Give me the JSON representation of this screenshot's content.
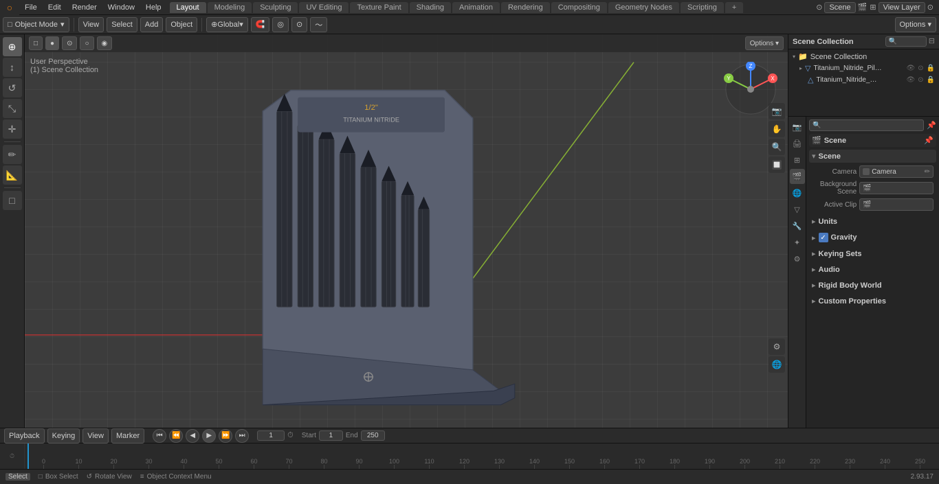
{
  "app": {
    "title": "Blender",
    "version": "2.93.17"
  },
  "menu_bar": {
    "logo": "○",
    "items": [
      "File",
      "Edit",
      "Render",
      "Window",
      "Help"
    ],
    "workspace_tabs": [
      {
        "label": "Layout",
        "active": true
      },
      {
        "label": "Modeling"
      },
      {
        "label": "Sculpting"
      },
      {
        "label": "UV Editing"
      },
      {
        "label": "Texture Paint"
      },
      {
        "label": "Shading"
      },
      {
        "label": "Animation"
      },
      {
        "label": "Rendering"
      },
      {
        "label": "Compositing"
      },
      {
        "label": "Geometry Nodes"
      },
      {
        "label": "Scripting"
      },
      {
        "label": "+"
      }
    ],
    "scene_name": "Scene",
    "view_layer": "View Layer"
  },
  "toolbar": {
    "mode": "Object Mode",
    "view_label": "View",
    "select_label": "Select",
    "add_label": "Add",
    "object_label": "Object",
    "global_label": "Global",
    "options_label": "Options ▾"
  },
  "left_tools": [
    {
      "name": "cursor-tool",
      "icon": "+"
    },
    {
      "name": "move-tool",
      "icon": "↕"
    },
    {
      "name": "rotate-tool",
      "icon": "↺"
    },
    {
      "name": "scale-tool",
      "icon": "⤡"
    },
    {
      "name": "transform-tool",
      "icon": "✛"
    },
    {
      "name": "annotate-tool",
      "icon": "✏"
    },
    {
      "name": "measure-tool",
      "icon": "📏"
    },
    {
      "name": "add-tool",
      "icon": "□"
    }
  ],
  "viewport": {
    "perspective": "User Perspective",
    "collection": "(1) Scene Collection",
    "axes_colors": {
      "x": "#ff4444",
      "y": "#88cc44",
      "z": "#4488ff"
    }
  },
  "outliner": {
    "title": "Scene Collection",
    "items": [
      {
        "name": "Titanium_Nitride_Pilot_Point_...",
        "icon": "▸",
        "type": "mesh",
        "icons": [
          "👁",
          "⊙",
          "🔒"
        ]
      },
      {
        "name": "Titanium_Nitride_Pilot_Pc",
        "icon": " ",
        "type": "mesh",
        "icons": [
          "👁",
          "⊙",
          "🔒"
        ],
        "indent": true
      }
    ]
  },
  "properties": {
    "active_tab": "scene",
    "scene_title": "Scene",
    "sections": {
      "scene": {
        "title": "Scene",
        "camera_label": "Camera",
        "camera_value": "Camera",
        "background_scene_label": "Background Scene",
        "active_clip_label": "Active Clip"
      },
      "units": {
        "title": "Units"
      },
      "gravity": {
        "title": "Gravity",
        "enabled": true
      },
      "keying_sets": {
        "title": "Keying Sets"
      },
      "audio": {
        "title": "Audio"
      },
      "rigid_body_world": {
        "title": "Rigid Body World"
      },
      "custom_properties": {
        "title": "Custom Properties"
      }
    },
    "icon_tabs": [
      {
        "name": "render",
        "icon": "📷"
      },
      {
        "name": "output",
        "icon": "🖨"
      },
      {
        "name": "view-layer",
        "icon": "🔲"
      },
      {
        "name": "scene",
        "icon": "🎬",
        "active": true
      },
      {
        "name": "world",
        "icon": "🌐"
      },
      {
        "name": "object",
        "icon": "▽"
      },
      {
        "name": "modifiers",
        "icon": "🔧"
      },
      {
        "name": "particles",
        "icon": "✦"
      },
      {
        "name": "physics",
        "icon": "⚙"
      }
    ]
  },
  "timeline": {
    "playback_label": "Playback",
    "keying_label": "Keying",
    "view_label": "View",
    "marker_label": "Marker",
    "current_frame": "1",
    "start_label": "Start",
    "start_value": "1",
    "end_label": "End",
    "end_value": "250",
    "frame_marks": [
      "0",
      "10",
      "20",
      "30",
      "40",
      "50",
      "60",
      "70",
      "80",
      "90",
      "100",
      "110",
      "120",
      "130",
      "140",
      "150",
      "160",
      "170",
      "180",
      "190",
      "200",
      "210",
      "220",
      "230",
      "240",
      "250"
    ]
  },
  "status_bar": {
    "select_key": "Select",
    "select_desc": "",
    "box_select_icon": "□",
    "box_select_label": "Box Select",
    "rotate_view_icon": "↺",
    "rotate_view_label": "Rotate View",
    "context_menu_icon": "≡",
    "context_menu_label": "Object Context Menu",
    "version": "2.93.17"
  }
}
